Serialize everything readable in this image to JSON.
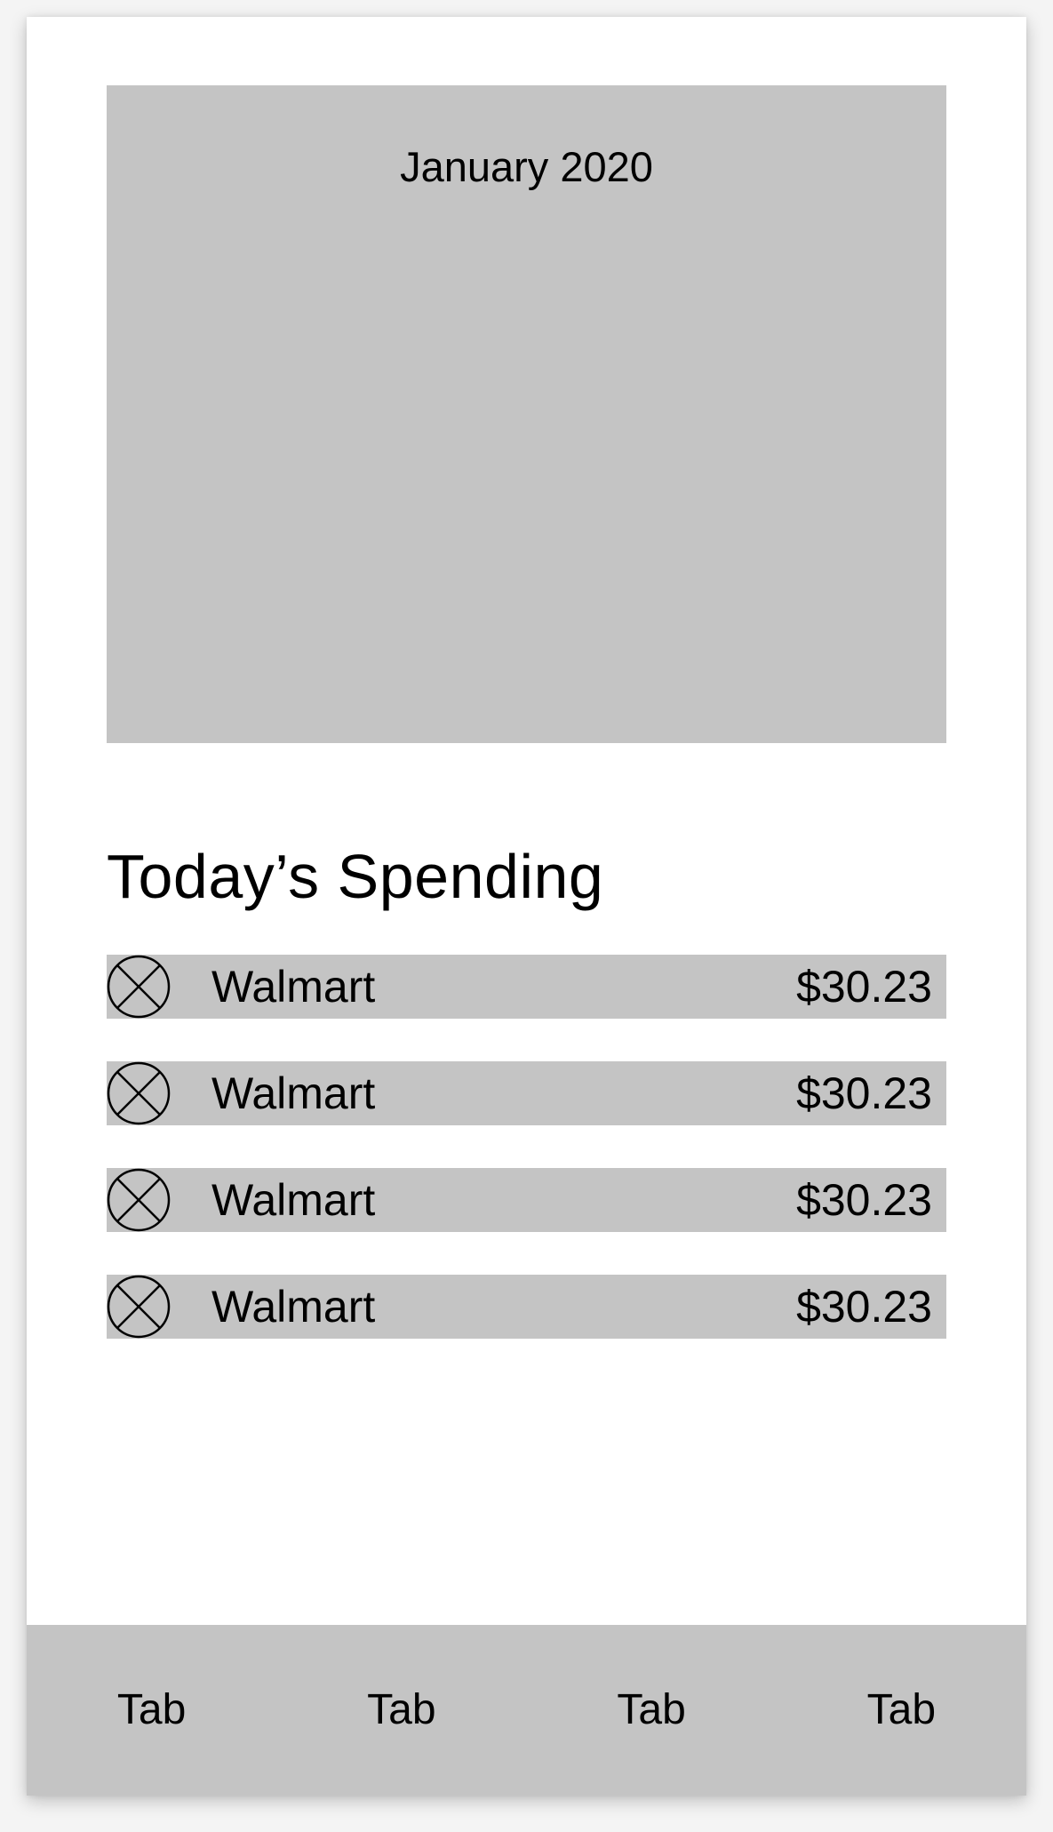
{
  "header": {
    "month_label": "January 2020"
  },
  "spending": {
    "title": "Today’s Spending",
    "items": [
      {
        "icon": "circle-x-icon",
        "merchant": "Walmart",
        "amount": "$30.23"
      },
      {
        "icon": "circle-x-icon",
        "merchant": "Walmart",
        "amount": "$30.23"
      },
      {
        "icon": "circle-x-icon",
        "merchant": "Walmart",
        "amount": "$30.23"
      },
      {
        "icon": "circle-x-icon",
        "merchant": "Walmart",
        "amount": "$30.23"
      }
    ]
  },
  "tabbar": {
    "tabs": [
      {
        "label": "Tab"
      },
      {
        "label": "Tab"
      },
      {
        "label": "Tab"
      },
      {
        "label": "Tab"
      }
    ]
  },
  "colors": {
    "placeholder_gray": "#c4c4c4",
    "background": "#ffffff",
    "text": "#000000"
  }
}
